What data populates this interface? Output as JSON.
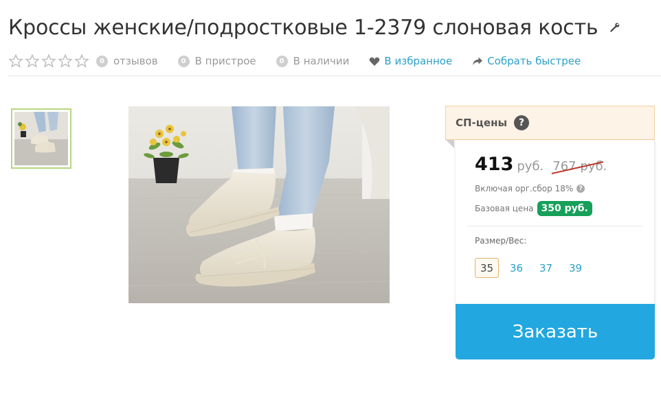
{
  "product": {
    "title": "Кроссы женские/подростковые 1-2379 слоновая кость"
  },
  "meta": {
    "rating": 0,
    "rating_max": 5,
    "reviews_count": "0",
    "reviews_label": "отзывов",
    "attach_count": "0",
    "attach_label": "В пристрое",
    "stock_count": "0",
    "stock_label": "В наличии",
    "favorite_label": "В избранное",
    "collect_label": "Собрать быстрее"
  },
  "sp": {
    "header": "СП-цены",
    "help": "?",
    "price": "413",
    "currency": "руб.",
    "old_price": "767 руб.",
    "fee_text": "Включая орг.сбор 18%",
    "base_label": "Базовая цена",
    "base_price": "350 руб.",
    "size_label": "Размер/Вес:",
    "sizes": [
      "35",
      "36",
      "37",
      "39"
    ],
    "selected_size": "35",
    "order_label": "Заказать"
  },
  "colors": {
    "accent": "#22a7e0",
    "link": "#2aa0c9",
    "base_badge": "#16a05a",
    "strike": "#c0392b"
  }
}
